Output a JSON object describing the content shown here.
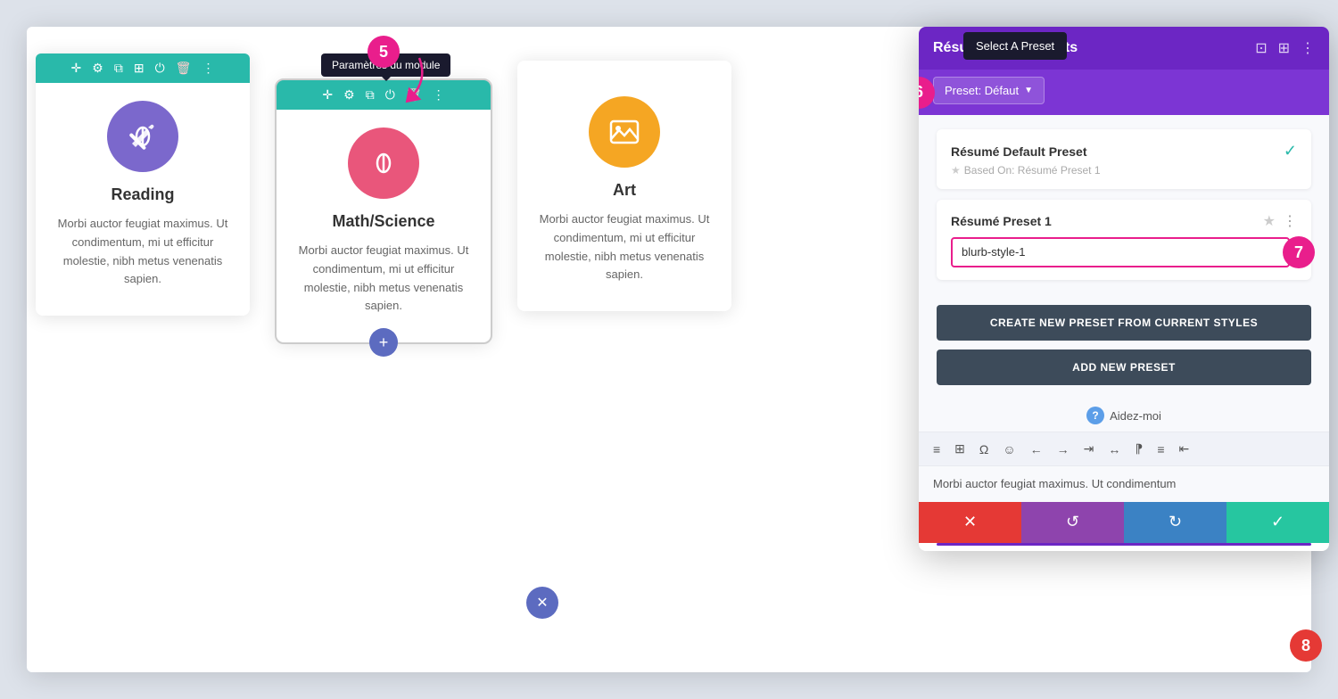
{
  "scene": {
    "background": "#dde2ea"
  },
  "cards": [
    {
      "id": "reading",
      "title": "Reading",
      "text": "Morbi auctor feugiat maximus. Ut condimentum, mi ut efficitur molestie, nibh metus venenatis sapien.",
      "icon_type": "pencil",
      "circle_color": "purple"
    },
    {
      "id": "math",
      "title": "Math/Science",
      "text": "Morbi auctor feugiat maximus. Ut condimentum, mi ut efficitur molestie, nibh metus venenatis sapien.",
      "icon_type": "pencil",
      "circle_color": "pink",
      "active": true
    },
    {
      "id": "art",
      "title": "Art",
      "text": "Morbi auctor feugiat maximus. Ut condimentum, mi ut efficitur molestie, nibh metus venenatis sapien.",
      "icon_type": "image",
      "circle_color": "orange"
    }
  ],
  "tooltip_module": "Paramètres du module",
  "step5_label": "5",
  "step6_label": "6",
  "step8_label": "8",
  "settings_panel": {
    "header_title": "Résumé Alignements",
    "preset_label": "Preset: Défaut",
    "select_preset_tooltip": "Select A Preset",
    "presets": [
      {
        "name": "Résumé Default Preset",
        "sub": "Based On: Résumé Preset 1",
        "is_default": true,
        "checked": true
      },
      {
        "name": "Résumé Preset 1",
        "input_value": "blurb-style-1",
        "is_default": false,
        "checked": false
      }
    ],
    "create_btn_label": "CREATE NEW PRESET FROM CURRENT STYLES",
    "add_btn_label": "ADD NEW PRESET",
    "help_label": "Aidez-moi",
    "preview_text": "Morbi auctor feugiat maximus. Ut condimentum",
    "toolbar_icons": [
      "≡",
      "⊞",
      "Ω",
      "☺",
      "←",
      "→"
    ],
    "bottom_btns": [
      {
        "icon": "✕",
        "color": "red"
      },
      {
        "icon": "↺",
        "color": "purple"
      },
      {
        "icon": "↻",
        "color": "blue"
      },
      {
        "icon": "✓",
        "color": "teal"
      }
    ]
  }
}
